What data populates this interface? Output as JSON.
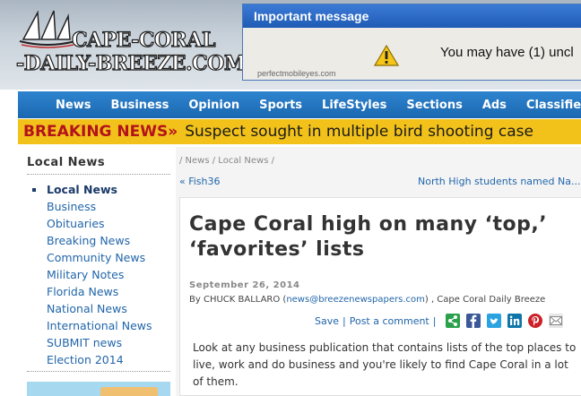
{
  "logo": {
    "line1": "CAPE-CORAL",
    "line2": "-DAILY-BREEZE.COM"
  },
  "ad": {
    "title": "Important message",
    "text": "You may have (1) uncl",
    "source": "perfectmobileyes.com"
  },
  "nav": {
    "items": [
      "News",
      "Business",
      "Opinion",
      "Sports",
      "LifeStyles",
      "Sections",
      "Ads",
      "Classifieds"
    ]
  },
  "breaking": {
    "label": "BREAKING NEWS»",
    "text": "Suspect sought in multiple bird shooting case"
  },
  "sidebar": {
    "title": "Local News",
    "items": [
      "Local News",
      "Business",
      "Obituaries",
      "Breaking News",
      "Community News",
      "Military Notes",
      "Florida News",
      "National News",
      "International News",
      "SUBMIT news",
      "Election 2014"
    ]
  },
  "main": {
    "breadcrumb": "/ News / Local News /",
    "prev": "« Fish36",
    "next": "North High students named Na..."
  },
  "article": {
    "headline": "Cape Coral high on many ‘top,’ ‘favorites’ lists",
    "date": "September 26, 2014",
    "by_prefix": "By CHUCK BALLARO (",
    "email": "news@breezenewspapers.com",
    "by_suffix": ") , Cape Coral Daily Breeze",
    "save": "Save",
    "comment": "Post a comment",
    "sep": "|",
    "body": "Look at any business publication that contains lists of the top places to live, work and do business and you're likely to find Cape Coral in a lot of them."
  },
  "colors": {
    "nav_blue": "#1f6fbf",
    "breaking_yellow": "#f2c21b",
    "breaking_red": "#b3131b",
    "link_blue": "#2266aa"
  },
  "icons": [
    "warning-icon",
    "share-icon",
    "facebook-icon",
    "twitter-icon",
    "linkedin-icon",
    "pinterest-icon",
    "email-icon"
  ]
}
